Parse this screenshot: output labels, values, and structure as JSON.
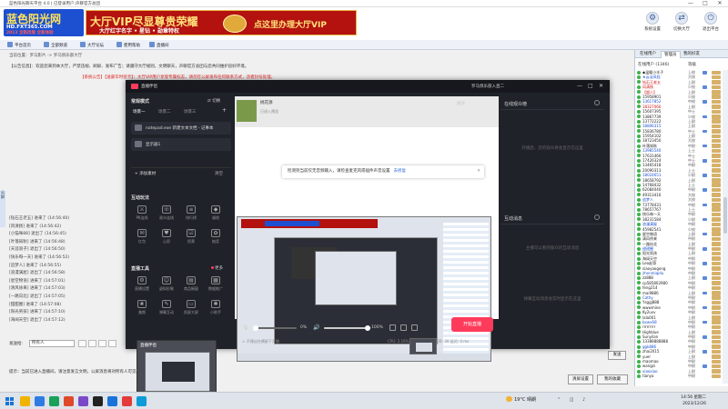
{
  "window": {
    "title": "蓝色阳光聊天平台 4.0 | 已登录用户:声聊官方总团",
    "min": "—",
    "max": "□",
    "close": "✕"
  },
  "brand": {
    "logo_main": "蓝色阳光网",
    "logo_domain": "HD.FXT365.COM",
    "logo_slogan": "2013 全新改版 全新体验",
    "vip_title": "大厅VIP尽显尊贵荣耀",
    "vip_sub": "大厅红字名字 • 星钻 • 勋章特权",
    "vip_cta": "点这里办理大厅VIP",
    "colors": {
      "logo_bg": "#1d4fd1",
      "banner_bg": "#b3120f",
      "gold": "#ffe27a",
      "accent": "#ff3b5c"
    }
  },
  "top_tools": [
    {
      "label": "系统设置",
      "icon": "gear-icon",
      "glyph": "⚙"
    },
    {
      "label": "切换大厅",
      "icon": "switch-icon",
      "glyph": "⇄"
    },
    {
      "label": "退出平台",
      "icon": "exit-icon",
      "glyph": "⏻"
    }
  ],
  "nav": [
    {
      "label": "平台首页",
      "icon": "home-icon"
    },
    {
      "label": "全部频道",
      "icon": "channel-icon"
    },
    {
      "label": "大厅论坛",
      "icon": "forum-icon"
    },
    {
      "label": "使用帮助",
      "icon": "help-icon"
    },
    {
      "label": "直播间",
      "icon": "room-icon"
    }
  ],
  "location": {
    "prefix": "当前位置：",
    "path": "罗马影片 -> 罗马俱乐部大厅"
  },
  "notice": "【公告信息】：欢迎您来到本大厅，严禁违规、刷屏、发布广告；请遵守大厅规则，文明聊天，声聊官方总团与您共同维护良好环境。",
  "notice_red": "【系统公告】【送豪华时装卡】：大厅VIP用户享受专属标志，请勿在公屏发布任何联系方式，违者封号处理。",
  "side_label": "公屏",
  "chat_log": [
    "[钻石王老五] 进来了 (14:56:40)",
    "[风清扬] 进来了 (14:56:42)",
    "[小猫咪88] 退出了 (14:56:45)",
    "[叶落知秋] 进来了 (14:56:48)",
    "[天涯浪子] 退出了 (14:56:50)",
    "[快乐每一天] 进来了 (14:56:52)",
    "[追梦人] 进来了 (14:56:55)",
    "[浪漫满屋] 退出了 (14:56:58)",
    "[星空物语] 进来了 (14:57:01)",
    "[清风徐来] 进来了 (14:57:03)",
    "[一路向北] 退出了 (14:57:05)",
    "[甜甜圈] 进来了 (14:57:08)",
    "[阳光男孩] 进来了 (14:57:10)",
    "[海阔天空] 退出了 (14:57:12)"
  ],
  "input": {
    "label": "发送给:",
    "target": "所有人",
    "send": "发送"
  },
  "tip": "提示：当前已进入直播间，请注意发言文明，公屏消息将对所有人可见。",
  "bottom_buttons": {
    "a": "清屏设置",
    "b": "我的收藏"
  },
  "user_panel": {
    "tabs": [
      "在线用户",
      "管理员",
      "我的好友"
    ],
    "active_tab": 1,
    "header": "在线用户 (1346)",
    "col_level": "等级",
    "users": [
      {
        "name": "◆温暖小丰子",
        "lv": "上校"
      },
      {
        "name": "★云淡风轻",
        "lv": "大校"
      },
      {
        "name": "钻石王老五",
        "lv": "上尉"
      },
      {
        "name": "风清扬",
        "lv": "少校"
      },
      {
        "name": "【超人】",
        "lv": "上尉"
      },
      {
        "name": "15958901",
        "lv": "少校"
      },
      {
        "name": "13617852",
        "lv": "中校"
      },
      {
        "name": "18327066",
        "lv": "上尉"
      },
      {
        "name": "15607395",
        "lv": "中士"
      },
      {
        "name": "13867739",
        "lv": "少校"
      },
      {
        "name": "13772222",
        "lv": "上尉"
      },
      {
        "name": "18806315",
        "lv": "上尉"
      },
      {
        "name": "15836780",
        "lv": "中士"
      },
      {
        "name": "15954102",
        "lv": "上尉"
      },
      {
        "name": "18723450",
        "lv": "大校"
      },
      {
        "name": "叶落知秋",
        "lv": "中尉"
      },
      {
        "name": "13985540",
        "lv": "上士"
      },
      {
        "name": "17631466",
        "lv": "中士"
      },
      {
        "name": "17426324",
        "lv": "中士"
      },
      {
        "name": "13465418",
        "lv": "中尉"
      },
      {
        "name": "20090313",
        "lv": "上士"
      },
      {
        "name": "18024651",
        "lv": "少尉"
      },
      {
        "name": "18658792",
        "lv": "上尉"
      },
      {
        "name": "14768432",
        "lv": "上士"
      },
      {
        "name": "62084040",
        "lv": "中尉"
      },
      {
        "name": "49313416",
        "lv": "大校"
      },
      {
        "name": "追梦人",
        "lv": "大校"
      },
      {
        "name": "73778431",
        "lv": "中尉"
      },
      {
        "name": "78657767",
        "lv": "上士"
      },
      {
        "name": "快乐每一天",
        "lv": "中尉"
      },
      {
        "name": "38231584",
        "lv": "少尉"
      },
      {
        "name": "浪漫满屋",
        "lv": "中尉"
      },
      {
        "name": "45982541",
        "lv": "少校"
      },
      {
        "name": "星空物语",
        "lv": "上尉"
      },
      {
        "name": "清风徐来",
        "lv": "中尉"
      },
      {
        "name": "一路向北",
        "lv": "上尉"
      },
      {
        "name": "甜甜圈",
        "lv": "中尉"
      },
      {
        "name": "阳光男孩",
        "lv": "上尉"
      },
      {
        "name": "海阔天空",
        "lv": "中尉"
      },
      {
        "name": "Leo赵哥",
        "lv": "中尉"
      },
      {
        "name": "siaoyaogong",
        "lv": "中尉"
      },
      {
        "name": "zhenmiqidu",
        "lv": "中尉"
      },
      {
        "name": "zz888",
        "lv": "上尉"
      },
      {
        "name": "cp585802980",
        "lv": "中尉"
      },
      {
        "name": "feng214",
        "lv": "中尉"
      },
      {
        "name": "mai9886",
        "lv": "上尉"
      },
      {
        "name": "Cathy",
        "lv": "中尉"
      },
      {
        "name": "Ysggj888",
        "lv": "中尉"
      },
      {
        "name": "wwwmine",
        "lv": "中尉"
      },
      {
        "name": "Ky2uvv",
        "lv": "中尉"
      },
      {
        "name": "lala001",
        "lv": "上尉"
      },
      {
        "name": "bxwx68",
        "lv": "中尉"
      },
      {
        "name": "rrrrrrrrr",
        "lv": "中尉"
      },
      {
        "name": "Highblue",
        "lv": "上尉"
      },
      {
        "name": "Sunyilan",
        "lv": "中尉"
      },
      {
        "name": "13388888888",
        "lv": "中尉"
      },
      {
        "name": "ggk886",
        "lv": "中尉"
      },
      {
        "name": "zhai2015",
        "lv": "上尉"
      },
      {
        "name": "yuer",
        "lv": "上尉"
      },
      {
        "name": "maomao",
        "lv": "中尉"
      },
      {
        "name": "wangzi",
        "lv": "中尉"
      },
      {
        "name": "xiaoxiao",
        "lv": "上尉"
      },
      {
        "name": "tianya",
        "lv": "中尉"
      }
    ]
  },
  "stream": {
    "title": "直播伴侣",
    "account": "罗马俱乐部入直二",
    "mode": "常规模式",
    "mode_switch": "⇄ 切换",
    "scenes": [
      "场景一",
      "场景二",
      "场景三"
    ],
    "sources": [
      "notepad.exe 新建文本文档 - 记事本",
      "显示器1"
    ],
    "add_source": "+ 添加素材",
    "add_source_right": "清空",
    "interact_title": "互动玩法",
    "interact": [
      {
        "label": "PK连线",
        "glyph": "⚔"
      },
      {
        "label": "观众连线",
        "glyph": "☏"
      },
      {
        "label": "排行榜",
        "glyph": "≡"
      },
      {
        "label": "福袋",
        "glyph": "◆"
      },
      {
        "label": "红包",
        "glyph": "✉"
      },
      {
        "label": "心愿",
        "glyph": "♥"
      },
      {
        "label": "投票",
        "glyph": "☑"
      },
      {
        "label": "抽奖",
        "glyph": "✿"
      }
    ],
    "tools_title": "直播工具",
    "tools_more": "更多",
    "tools": [
      {
        "label": "直播设置",
        "glyph": "⚙"
      },
      {
        "label": "虚拟形象",
        "glyph": "☺"
      },
      {
        "label": "商品橱窗",
        "glyph": "▤"
      },
      {
        "label": "数据推广",
        "glyph": "▦"
      },
      {
        "label": "美颜",
        "glyph": "❀"
      },
      {
        "label": "弹幕互动",
        "glyph": "✎"
      },
      {
        "label": "投屏大屏",
        "glyph": "▭"
      },
      {
        "label": "小助手",
        "glyph": "✱"
      }
    ],
    "preview_title": "桃花源",
    "preview_sub": "已进入预览",
    "toast": "检测到当前仅无音频输入，请检查麦克风或插件声音设置",
    "toast_link": "去修复",
    "toast_close": "✕",
    "toast_extra": "播放",
    "mic_percent": "0%",
    "speaker_percent": "100%",
    "mic_level": 0.0,
    "speaker_level": 1.0,
    "start_btn": "开始直播",
    "status_left": "⚠ 不建议在横屏下开播",
    "status_right": "CPU: 2.16%   内存: 41.54%   帧率: 30   延迟: 0 ms",
    "panel1_title": "在线观众榜",
    "panel1_empty": "开播后，您的观众将会显示在这里",
    "panel2_title": "互动消息",
    "panel2_empty": "主播可以看到观众的互动消息",
    "panel2_empty2": "弹幕互动消息会实时显示在这里",
    "float_title": "直播伴侣"
  },
  "taskbar": {
    "weather": "19°C 晴朗",
    "time": "14:56 星期二",
    "date": "2023/12/26",
    "apps": [
      "#f0b400",
      "#2e7be3",
      "#1aa05a",
      "#e0482a",
      "#7a49c8",
      "#222",
      "#1a73d9",
      "#e33b3b",
      "#0f9bd7"
    ]
  }
}
